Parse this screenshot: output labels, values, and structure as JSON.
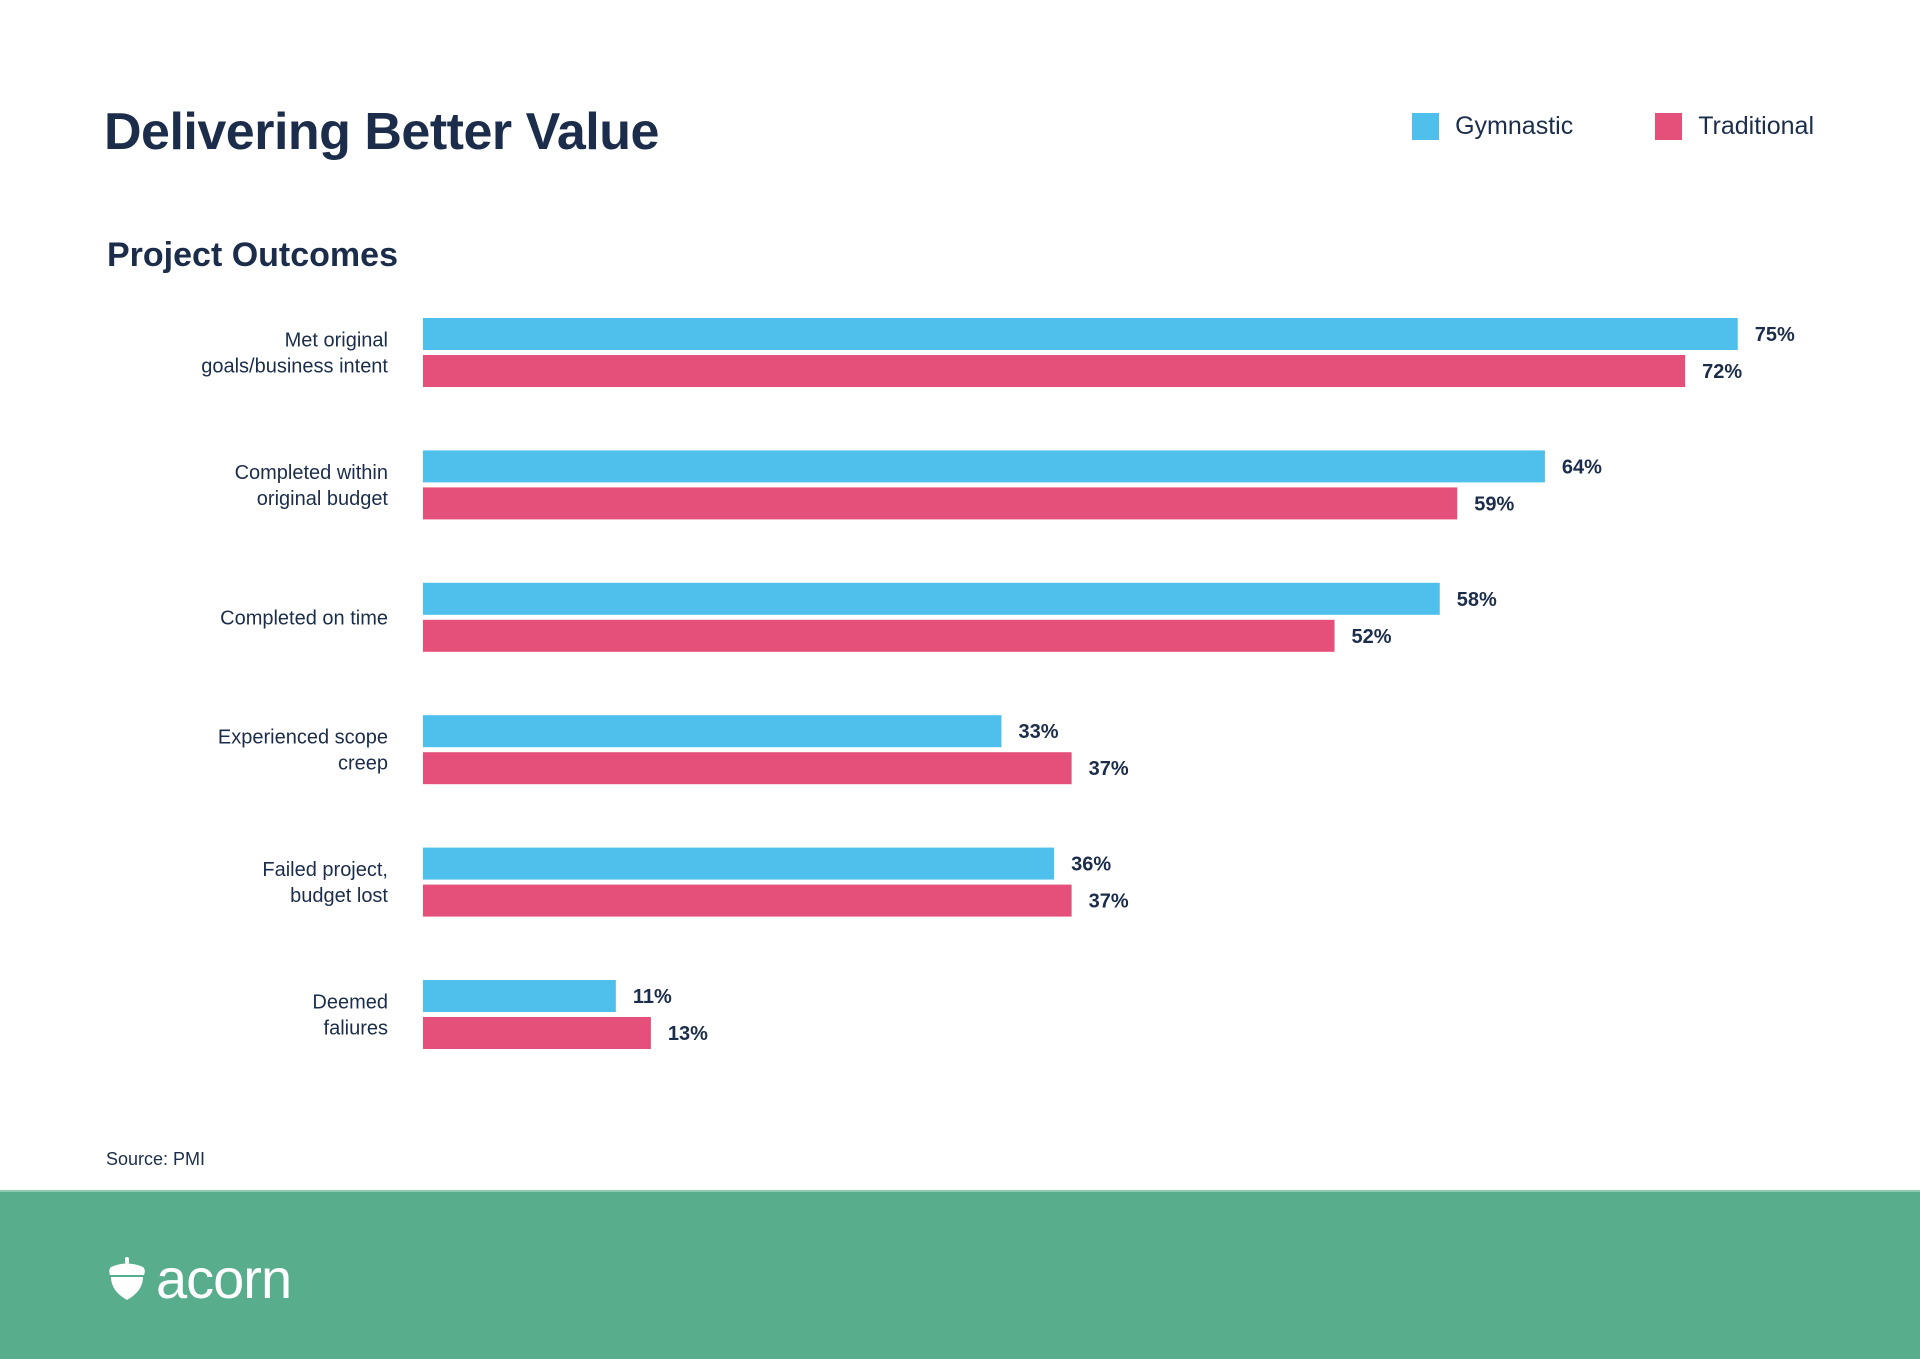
{
  "header": {
    "title": "Delivering Better Value",
    "subtitle": "Project Outcomes"
  },
  "legend": [
    {
      "label": "Gymnastic",
      "color": "#4fc0eb"
    },
    {
      "label": "Traditional",
      "color": "#e5507a"
    }
  ],
  "chart_data": {
    "type": "bar",
    "orientation": "horizontal",
    "title": "Project Outcomes",
    "xlabel": "",
    "ylabel": "",
    "xlim": [
      0,
      100
    ],
    "grid": false,
    "legend_position": "top-right",
    "categories": [
      "Met original goals/business intent",
      "Completed within original budget",
      "Completed on time",
      "Experienced scope creep",
      "Failed project, budget lost",
      "Deemed faliures"
    ],
    "category_lines": [
      [
        "Met original",
        "goals/business intent"
      ],
      [
        "Completed within",
        "original budget"
      ],
      [
        "Completed on time"
      ],
      [
        "Experienced scope",
        "creep"
      ],
      [
        "Failed project,",
        "budget lost"
      ],
      [
        "Deemed",
        "faliures"
      ]
    ],
    "series": [
      {
        "name": "Gymnastic",
        "color": "#4fc0eb",
        "values": [
          75,
          64,
          58,
          33,
          36,
          11
        ],
        "labels": [
          "75%",
          "64%",
          "58%",
          "33%",
          "36%",
          "11%"
        ]
      },
      {
        "name": "Traditional",
        "color": "#e5507a",
        "values": [
          72,
          59,
          52,
          37,
          37,
          13
        ],
        "labels": [
          "72%",
          "59%",
          "52%",
          "37%",
          "37%",
          "13%"
        ]
      }
    ]
  },
  "source": "Source: PMI",
  "footer": {
    "brand": "acorn",
    "background": "#57ad8c"
  }
}
